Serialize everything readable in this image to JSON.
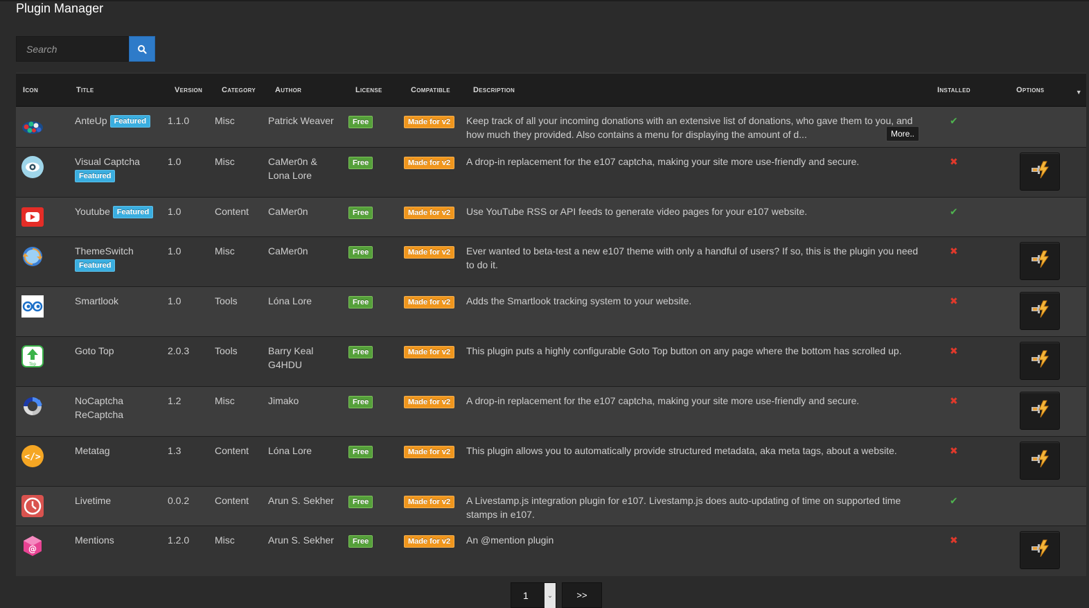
{
  "page": {
    "title": "Plugin Manager"
  },
  "search": {
    "placeholder": "Search"
  },
  "table": {
    "headers": {
      "icon": "Icon",
      "title": "Title",
      "version": "Version",
      "category": "Category",
      "author": "Author",
      "license": "License",
      "compatible": "Compatible",
      "description": "Description",
      "installed": "Installed",
      "options": "Options"
    },
    "rows": [
      {
        "icon": "anteup-icon",
        "title": "AnteUp",
        "featured": "Featured",
        "version": "1.1.0",
        "category": "Misc",
        "author": "Patrick Weaver",
        "license": "Free",
        "compatible": "Made for v2",
        "description": "Keep track of all your incoming donations with an extensive list of donations, who gave them to you, and how much they provided. Also contains a menu for displaying the amount of d...",
        "more": "More..",
        "installed": true
      },
      {
        "icon": "visual-captcha-icon",
        "title": "Visual Captcha",
        "featured": "Featured",
        "version": "1.0",
        "category": "Misc",
        "author": "CaMer0n & Lona Lore",
        "license": "Free",
        "compatible": "Made for v2",
        "description": "A drop-in replacement for the e107 captcha, making your site more use-friendly and secure.",
        "installed": false
      },
      {
        "icon": "youtube-icon",
        "title": "Youtube",
        "featured": "Featured",
        "version": "1.0",
        "category": "Content",
        "author": "CaMer0n",
        "license": "Free",
        "compatible": "Made for v2",
        "description": "Use YouTube RSS or API feeds to generate video pages for your e107 website.",
        "installed": true
      },
      {
        "icon": "themeswitch-icon",
        "title": "ThemeSwitch",
        "featured": "Featured",
        "version": "1.0",
        "category": "Misc",
        "author": "CaMer0n",
        "license": "Free",
        "compatible": "Made for v2",
        "description": "Ever wanted to beta-test a new e107 theme with only a handful of users? If so, this is the plugin you need to do it.",
        "installed": false
      },
      {
        "icon": "smartlook-icon",
        "title": "Smartlook",
        "featured": "",
        "version": "1.0",
        "category": "Tools",
        "author": "Lóna Lore",
        "license": "Free",
        "compatible": "Made for v2",
        "description": "Adds the Smartlook tracking system to your website.",
        "installed": false
      },
      {
        "icon": "goto-top-icon",
        "title": "Goto Top",
        "featured": "",
        "version": "2.0.3",
        "category": "Tools",
        "author": "Barry Keal G4HDU",
        "license": "Free",
        "compatible": "Made for v2",
        "description": "This plugin puts a highly configurable Goto Top button on any page where the bottom has scrolled up.",
        "installed": false
      },
      {
        "icon": "nocaptcha-recaptcha-icon",
        "title": "NoCaptcha ReCaptcha",
        "featured": "",
        "version": "1.2",
        "category": "Misc",
        "author": "Jimako",
        "license": "Free",
        "compatible": "Made for v2",
        "description": "A drop-in replacement for the e107 captcha, making your site more use-friendly and secure.",
        "installed": false
      },
      {
        "icon": "metatag-icon",
        "title": "Metatag",
        "featured": "",
        "version": "1.3",
        "category": "Content",
        "author": "Lóna Lore",
        "license": "Free",
        "compatible": "Made for v2",
        "description": "This plugin allows you to automatically provide structured metadata, aka meta tags, about a website.",
        "installed": false
      },
      {
        "icon": "livetime-icon",
        "title": "Livetime",
        "featured": "",
        "version": "0.0.2",
        "category": "Content",
        "author": "Arun S. Sekher",
        "license": "Free",
        "compatible": "Made for v2",
        "description": "A Livestamp.js integration plugin for e107. Livestamp.js does auto-updating of time on supported time stamps in e107.",
        "installed": true
      },
      {
        "icon": "mentions-icon",
        "title": "Mentions",
        "featured": "",
        "version": "1.2.0",
        "category": "Misc",
        "author": "Arun S. Sekher",
        "license": "Free",
        "compatible": "Made for v2",
        "description": "An @mention plugin",
        "installed": false
      }
    ]
  },
  "pager": {
    "page": "1",
    "next": ">>"
  },
  "colors": {
    "accent": "#2e7bc9",
    "featured": "#3aaee0",
    "free": "#55a03a",
    "v2": "#f0961d",
    "installed": "#4fb44f",
    "not_installed": "#e0392b"
  }
}
